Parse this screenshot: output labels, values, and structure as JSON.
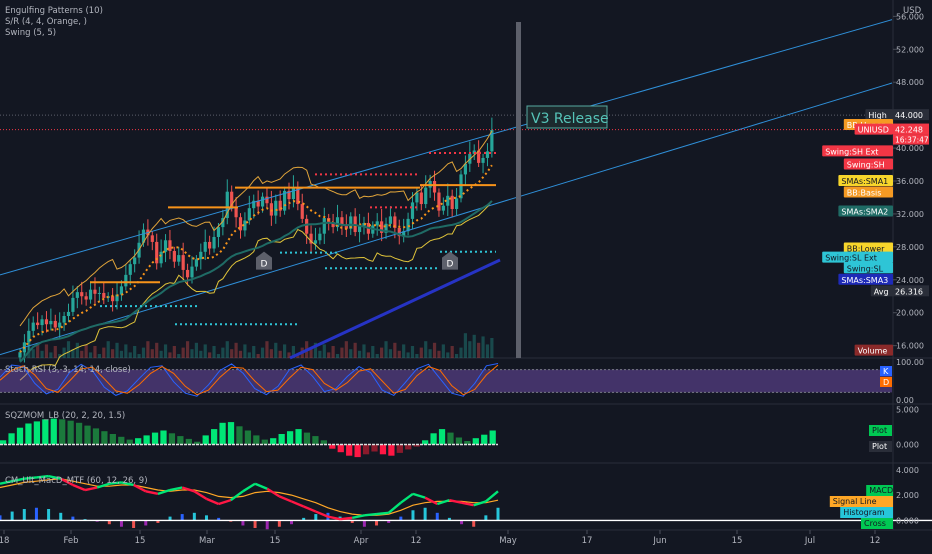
{
  "price_pane": {
    "indicators": [
      "Engulfing Patterns (10)",
      "S/R (4, 4, Orange, )",
      "Swing (5, 5)"
    ],
    "currency": "USD",
    "y_ticks": [
      56.0,
      52.0,
      48.0,
      44.0,
      40.0,
      36.0,
      32.0,
      28.0,
      24.0,
      20.0,
      16.0
    ],
    "y_tick_labels": [
      "56.000",
      "52.000",
      "48.000",
      "44.000",
      "40.000",
      "36.000",
      "32.000",
      "28.000",
      "24.000",
      "20.000",
      "16.000"
    ],
    "annotation": "V3 Release",
    "pattern_markers": [
      "D",
      "D"
    ],
    "axis_tags": [
      {
        "id": "high",
        "text": "High",
        "sub": "44.000",
        "color": "#2a2e39",
        "price": 44.0
      },
      {
        "id": "bbupper",
        "text": "BB:Upper",
        "color": "#f59a23",
        "price": 42.8
      },
      {
        "id": "uniusd",
        "text": "UNIUSD",
        "sub": "42.248",
        "sub2": "16:37:47",
        "color": "#f23645",
        "price": 42.248
      },
      {
        "id": "swingshext",
        "text": "Swing:SH Ext",
        "color": "#f23645",
        "price": 39.6
      },
      {
        "id": "swingsh",
        "text": "Swing:SH",
        "color": "#f23645",
        "price": 38.0
      },
      {
        "id": "smasma1",
        "text": "SMAs:SMA1",
        "color": "#f7d52b",
        "price": 36.0
      },
      {
        "id": "bbbasis",
        "text": "BB:Basis",
        "color": "#f59a23",
        "price": 34.6
      },
      {
        "id": "smasma2",
        "text": "SMAs:SMA2",
        "color": "#1f6b65",
        "price": 32.3
      },
      {
        "id": "bblower",
        "text": "BB:Lower",
        "color": "#f7d52b",
        "price": 27.8
      },
      {
        "id": "swingslext",
        "text": "Swing:SL Ext",
        "color": "#2ec5d6",
        "price": 26.7
      },
      {
        "id": "swingsl",
        "text": "Swing:SL",
        "color": "#2ec5d6",
        "price": 25.4
      },
      {
        "id": "smasma3",
        "text": "SMAs:SMA3",
        "color": "#1e2ab8",
        "price": 24.0
      },
      {
        "id": "avg",
        "text": "Avg",
        "sub": "26.316",
        "color": "#2a2e39",
        "price": 22.6
      },
      {
        "id": "volume",
        "text": "Volume",
        "color": "#8b2a2a",
        "price": 15.4
      }
    ]
  },
  "stoch_pane": {
    "title": "Stoch RSI (3, 3, 14, 14, close)",
    "y_tick_labels": [
      "100.00",
      "0.00"
    ],
    "tags": [
      "K",
      "D"
    ]
  },
  "sqz_pane": {
    "title": "SQZMOM_LB (20, 2, 20, 1.5)",
    "y_tick_labels": [
      "5.000",
      "0.000"
    ],
    "tags": [
      "Plot",
      "Plot"
    ]
  },
  "macd_pane": {
    "title": "CM_Ult_MacD_MTF (60, 12, 26, 9)",
    "y_tick_labels": [
      "4.000",
      "2.000",
      "0.000"
    ],
    "tags": [
      "MACD",
      "Signal Line",
      "Histogram",
      "Cross"
    ]
  },
  "time_axis": {
    "labels": [
      "18",
      "Feb",
      "15",
      "Mar",
      "15",
      "Apr",
      "12",
      "May",
      "17",
      "Jun",
      "15",
      "Jul",
      "12"
    ]
  },
  "colors": {
    "background": "#131722",
    "up": "#26a69a",
    "down": "#ef5350",
    "sr_orange": "#f7931a",
    "swing_cyan": "#2ec5d6",
    "swing_red": "#f23645",
    "channel_blue": "#2f8fd8",
    "sma3_blue": "#2633c4"
  },
  "chart_data": [
    {
      "type": "candlestick",
      "symbol": "UNIUSD",
      "x_range": [
        "Jan 18",
        "Jul 12"
      ],
      "ylim": [
        14.5,
        57.5
      ],
      "scale": "linear",
      "grid": false,
      "legend": "top-left",
      "last_price": 42.248,
      "high": 44.0,
      "avg": 26.316,
      "note": "daily candles, approximately read from the chart",
      "closes": [
        15.2,
        16.4,
        17.8,
        18.8,
        18.5,
        19.2,
        18.6,
        19.0,
        18.2,
        18.8,
        19.6,
        20.1,
        21.8,
        22.5,
        22.0,
        21.6,
        22.8,
        22.3,
        22.4,
        21.8,
        22.0,
        21.4,
        22.2,
        23.2,
        24.6,
        25.9,
        26.7,
        28.5,
        30.1,
        29.4,
        28.6,
        26.0,
        27.4,
        28.8,
        27.5,
        26.2,
        27.0,
        25.2,
        24.3,
        25.6,
        26.5,
        27.4,
        28.6,
        27.8,
        29.2,
        30.4,
        31.5,
        34.7,
        32.8,
        31.6,
        30.0,
        31.2,
        32.7,
        33.6,
        32.9,
        34.1,
        33.3,
        31.8,
        33.6,
        32.4,
        34.8,
        33.8,
        35.2,
        33.2,
        31.4,
        29.6,
        28.4,
        28.8,
        29.6,
        31.5,
        31.0,
        30.4,
        31.6,
        30.7,
        30.2,
        31.7,
        29.8,
        30.5,
        30.9,
        29.6,
        30.6,
        31.1,
        29.7,
        30.8,
        31.7,
        30.3,
        29.3,
        29.9,
        31.4,
        33.4,
        34.6,
        33.2,
        35.2,
        36.0,
        34.6,
        32.4,
        33.0,
        34.2,
        32.6,
        33.9,
        36.8,
        38.1,
        39.3,
        39.7,
        38.2,
        38.8,
        39.6,
        42.2
      ]
    },
    {
      "type": "line",
      "name": "Stoch RSI",
      "ylim": [
        0,
        100
      ],
      "series": [
        {
          "name": "K",
          "values": [
            60,
            92,
            88,
            44,
            16,
            28,
            72,
            94,
            76,
            34,
            12,
            24,
            56,
            86,
            90,
            48,
            18,
            10,
            40,
            78,
            95,
            70,
            30,
            14,
            36,
            80,
            92,
            62,
            22,
            30,
            62,
            88,
            72,
            26,
            12,
            46,
            82,
            94,
            56,
            18,
            10,
            44,
            90,
            96
          ]
        },
        {
          "name": "D",
          "values": [
            52,
            78,
            90,
            66,
            30,
            20,
            50,
            82,
            86,
            56,
            24,
            18,
            40,
            70,
            88,
            70,
            36,
            14,
            26,
            60,
            86,
            84,
            50,
            22,
            26,
            58,
            86,
            80,
            44,
            26,
            46,
            76,
            82,
            50,
            18,
            28,
            64,
            88,
            78,
            38,
            14,
            28,
            66,
            92
          ]
        }
      ]
    },
    {
      "type": "bar",
      "name": "SQZMOM_LB",
      "ylim": [
        -2.5,
        5.5
      ],
      "values": [
        0.6,
        1.6,
        2.4,
        3.0,
        3.3,
        3.6,
        3.7,
        3.6,
        3.4,
        3.1,
        2.7,
        2.3,
        1.9,
        1.5,
        1.1,
        0.7,
        0.9,
        1.3,
        1.7,
        2.0,
        1.6,
        1.2,
        0.8,
        0.4,
        1.3,
        2.2,
        3.1,
        3.2,
        2.6,
        2.0,
        1.3,
        0.7,
        0.9,
        1.5,
        1.9,
        2.2,
        1.7,
        1.2,
        0.6,
        -0.6,
        -1.1,
        -1.6,
        -1.8,
        -1.4,
        -1.0,
        -1.4,
        -1.6,
        -1.2,
        -0.7,
        -0.3,
        0.6,
        1.6,
        2.2,
        1.7,
        1.0,
        0.5,
        0.9,
        1.4,
        2.0
      ]
    },
    {
      "type": "line",
      "name": "CM_Ult_MacD_MTF",
      "ylim": [
        -0.6,
        4.3
      ],
      "series": [
        {
          "name": "MACD",
          "values": [
            2.9,
            3.1,
            3.3,
            3.4,
            3.5,
            3.3,
            2.8,
            2.4,
            2.6,
            2.9,
            3.0,
            2.8,
            2.3,
            2.1,
            2.4,
            2.6,
            2.3,
            1.7,
            1.3,
            1.6,
            2.3,
            2.9,
            2.5,
            1.9,
            1.5,
            1.1,
            0.7,
            0.3,
            0.1,
            0.2,
            0.4,
            0.5,
            0.6,
            1.4,
            2.1,
            1.8,
            1.3,
            1.6,
            1.4,
            1.2,
            1.5,
            2.3
          ]
        },
        {
          "name": "Signal Line",
          "values": [
            2.6,
            2.8,
            3.0,
            3.1,
            3.2,
            3.3,
            3.1,
            2.9,
            2.7,
            2.7,
            2.8,
            2.8,
            2.6,
            2.4,
            2.3,
            2.4,
            2.4,
            2.2,
            1.9,
            1.8,
            1.9,
            2.2,
            2.3,
            2.2,
            2.0,
            1.7,
            1.4,
            1.0,
            0.7,
            0.5,
            0.4,
            0.4,
            0.5,
            0.8,
            1.2,
            1.4,
            1.5,
            1.5,
            1.5,
            1.4,
            1.4,
            1.6
          ]
        },
        {
          "name": "Histogram",
          "values": [
            0.4,
            0.7,
            0.9,
            1.0,
            0.9,
            0.6,
            0.3,
            0.1,
            -0.1,
            -0.3,
            -0.5,
            -0.6,
            -0.4,
            -0.2,
            0.3,
            0.5,
            0.6,
            0.4,
            0.2,
            -0.1,
            -0.4,
            -0.6,
            -0.7,
            -0.5,
            -0.3,
            0.2,
            0.5,
            0.6,
            0.3,
            -0.2,
            -0.5,
            -0.4,
            -0.2,
            0.3,
            0.8,
            1.0,
            0.6,
            0.2,
            -0.3,
            -0.5,
            0.4,
            1.0
          ]
        }
      ]
    }
  ]
}
